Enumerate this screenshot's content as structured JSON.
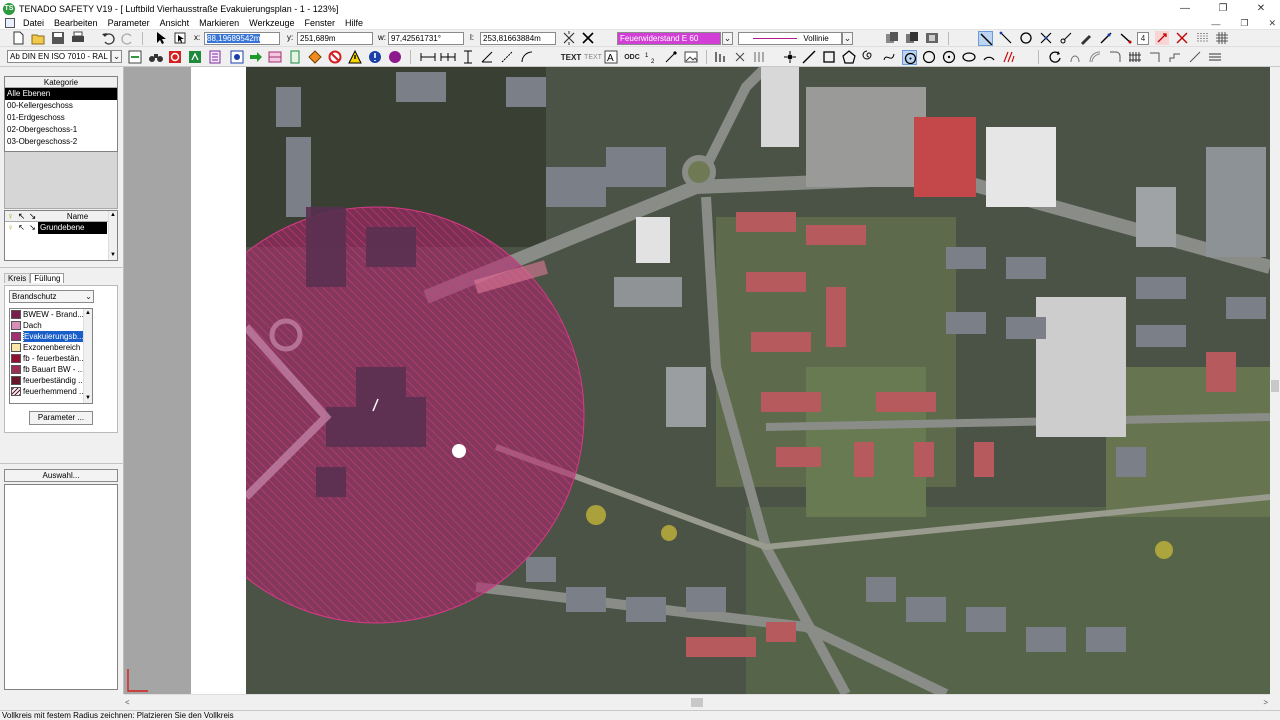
{
  "window": {
    "logo_text": "TS",
    "title": "TENADO SAFETY V19 - [ Luftbild Vierhausstraße Evakuierungsplan - 1 - 123%]"
  },
  "menu": [
    "Datei",
    "Bearbeiten",
    "Parameter",
    "Ansicht",
    "Markieren",
    "Werkzeuge",
    "Fenster",
    "Hilfe"
  ],
  "coords": {
    "x_label": "x:",
    "x_value": "88,19689542m",
    "y_label": "y:",
    "y_value": "251,689m",
    "w_label": "w:",
    "w_value": "97,42561731°",
    "l_label": "l:",
    "l_value": "253,81663884m"
  },
  "properties": {
    "fill_style": "Feuerwiderstand E 60",
    "fill_color": "#d23fd6",
    "line_style": "Vollinie",
    "layer_count": "4"
  },
  "toolbar2": {
    "standard": "Ab DIN EN ISO 7010 - RAL",
    "text_tool": "TEXT",
    "text_tool2": "TEXT",
    "odc_label": "ODC"
  },
  "kategorie": {
    "header": "Kategorie",
    "items": [
      "Alle Ebenen",
      "00-Kellergeschoss",
      "01-Erdgeschoss",
      "02-Obergeschoss-1",
      "03-Obergeschoss-2"
    ]
  },
  "ebenen": {
    "header": "Name",
    "items": [
      "Grundebene"
    ]
  },
  "tabs": [
    "Kreis",
    "Füllung"
  ],
  "fuellung": {
    "dropdown": "Brandschutz",
    "items": [
      {
        "label": "BWEW - Brand...",
        "color": "#7a1e4f"
      },
      {
        "label": "Dach",
        "color": "#d98eb8"
      },
      {
        "label": "Evakuierungsb...",
        "color": "#a33070"
      },
      {
        "label": "Exzonenbereich",
        "color": "#fbe7a4"
      },
      {
        "label": "fb - feuerbestän...",
        "color": "#8e1232"
      },
      {
        "label": "fb Bauart BW - ...",
        "color": "#9a2f55"
      },
      {
        "label": "feuerbeständig ...",
        "color": "#6b1628"
      },
      {
        "label": "feuerhemmend ...",
        "color": "#f2f2f2"
      }
    ],
    "parameter_button": "Parameter ..."
  },
  "auswahl_button": "Auswahl...",
  "status": "Vollkreis mit festem Radius zeichnen: Platzieren Sie den Vollkreis",
  "colors": {
    "circle_fill": "#b3226d",
    "selection": "#000000",
    "toolbar_highlight": "#bcd4f0"
  }
}
